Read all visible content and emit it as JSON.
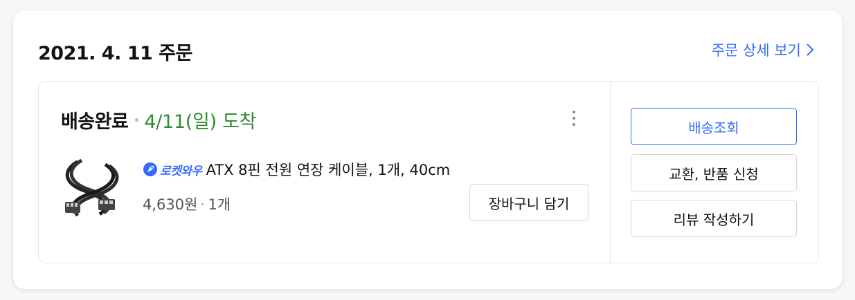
{
  "order": {
    "date_title": "2021. 4. 11 주문",
    "detail_link_label": "주문 상세 보기"
  },
  "shipment": {
    "status": "배송완료",
    "arrival": "4/11(일) 도착"
  },
  "product": {
    "badge": "로켓와우",
    "name": "ATX 8핀 전원 연장 케이블, 1개, 40cm",
    "price": "4,630원",
    "quantity": "1개",
    "image_icon": "cable-image",
    "cart_button_label": "장바구니 담기"
  },
  "actions": {
    "track_label": "배송조회",
    "return_label": "교환, 반품 신청",
    "review_label": "리뷰 작성하기"
  },
  "colors": {
    "accent": "#346aff",
    "delivered_green": "#2e8b2e"
  }
}
